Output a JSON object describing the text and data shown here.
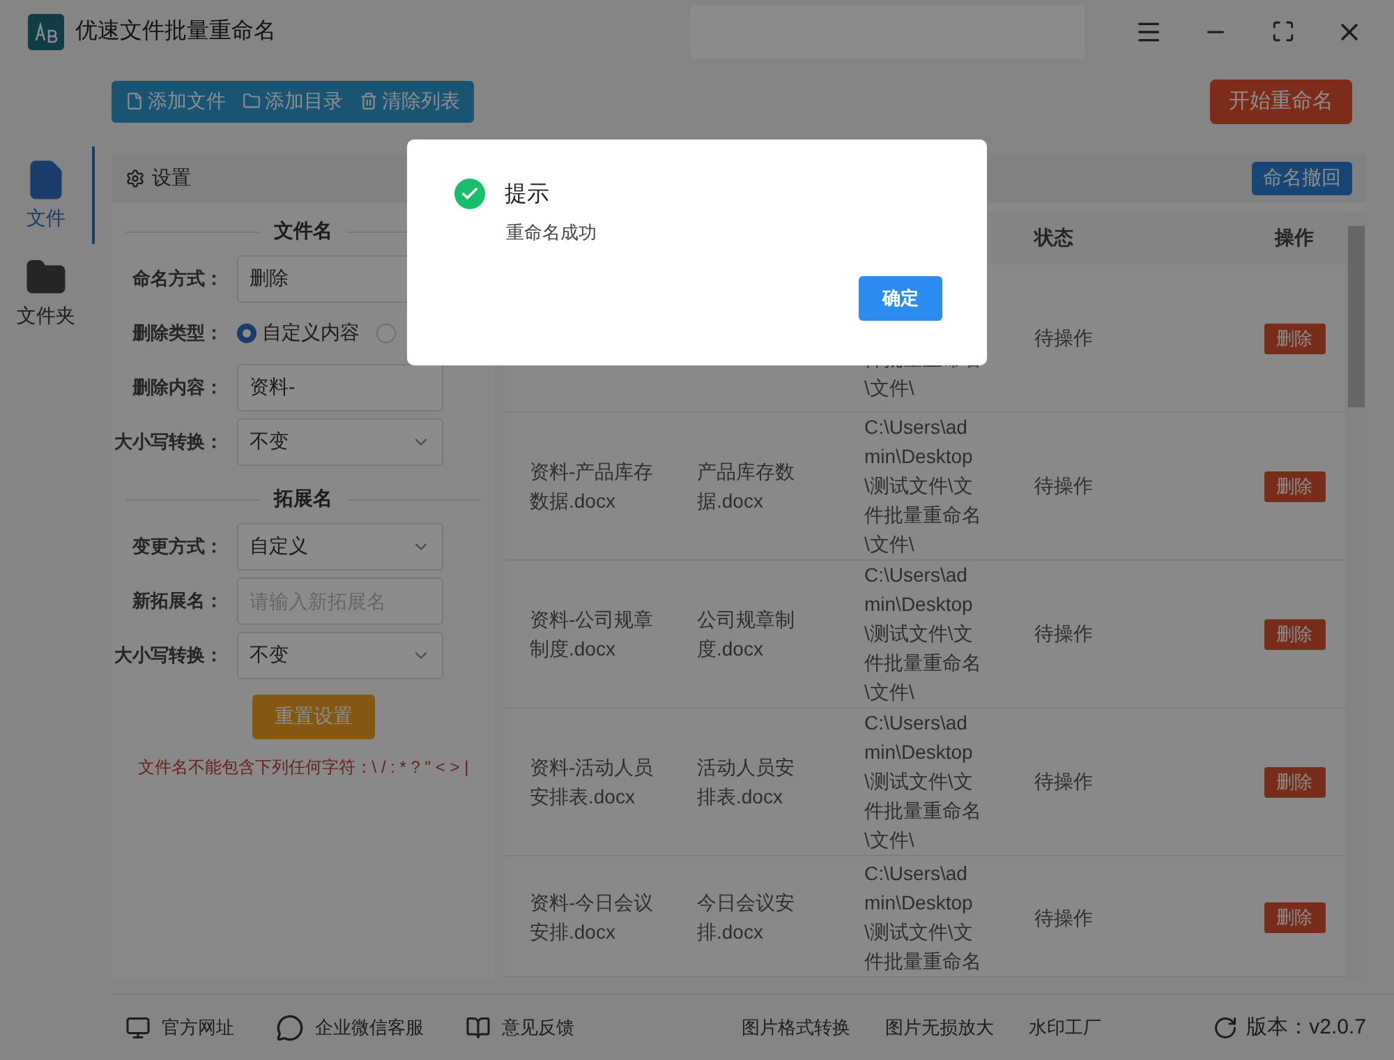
{
  "window": {
    "title": "优速文件批量重命名"
  },
  "toolbar": {
    "buttons": [
      {
        "kind": "file",
        "label": "添加文件"
      },
      {
        "kind": "folder",
        "label": "添加目录"
      },
      {
        "kind": "trash",
        "label": "清除列表"
      }
    ],
    "start_button": "开始重命名"
  },
  "sidebar": {
    "items": [
      {
        "kind": "file",
        "label": "文件",
        "selected": true
      },
      {
        "kind": "folder",
        "label": "文件夹",
        "selected": false
      }
    ]
  },
  "settings": {
    "title": "设置",
    "sections": [
      {
        "title": "文件名",
        "fields": [
          {
            "kind": "input",
            "label": "命名方式：",
            "value": "删除"
          },
          {
            "kind": "radio",
            "label": "删除类型：",
            "options": [
              {
                "label": "自定义内容",
                "selected": true
              },
              {
                "selected": false
              }
            ]
          },
          {
            "kind": "input",
            "label": "删除内容：",
            "value": "资料-"
          },
          {
            "kind": "select",
            "label": "大小写转换：",
            "value": "不变"
          }
        ]
      },
      {
        "title": "拓展名",
        "fields": [
          {
            "kind": "select",
            "label": "变更方式：",
            "value": "自定义"
          },
          {
            "kind": "input",
            "label": "新拓展名：",
            "placeholder": "请输入新拓展名"
          },
          {
            "kind": "select",
            "label": "大小写转换：",
            "value": "不变"
          }
        ]
      }
    ],
    "reset_button": "重置设置",
    "warning": "文件名不能包含下列任何字符：\\ / : * ? \" < > |"
  },
  "table": {
    "undo_button": "命名撤回",
    "headers": [
      "状态",
      "操作"
    ],
    "rows": [
      {
        "path": "件批量重命名\\文件\\",
        "status": "待操作",
        "action": "删除"
      },
      {
        "original": "资料-产品库存数据.docx",
        "renamed": "产品库存数据.docx",
        "path": "C:\\Users\\admin\\Desktop\\测试文件\\文件批量重命名\\文件\\",
        "status": "待操作",
        "action": "删除"
      },
      {
        "original": "资料-公司规章制度.docx",
        "renamed": "公司规章制度.docx",
        "path": "C:\\Users\\admin\\Desktop\\测试文件\\文件批量重命名\\文件\\",
        "status": "待操作",
        "action": "删除"
      },
      {
        "original": "资料-活动人员安排表.docx",
        "renamed": "活动人员安排表.docx",
        "path": "C:\\Users\\admin\\Desktop\\测试文件\\文件批量重命名\\文件\\",
        "status": "待操作",
        "action": "删除"
      },
      {
        "original": "资料-今日会议安排.docx",
        "renamed": "今日会议安排.docx",
        "path": "C:\\Users\\admin\\Desktop\\测试文件\\文件批量重命名",
        "status": "待操作",
        "action": "删除"
      }
    ]
  },
  "footer": {
    "links": [
      {
        "kind": "web",
        "label": "官方网址"
      },
      {
        "kind": "chat",
        "label": "企业微信客服"
      },
      {
        "kind": "feedback",
        "label": "意见反馈"
      }
    ],
    "tools": [
      "图片格式转换",
      "图片无损放大",
      "水印工厂"
    ],
    "version": "版本：v2.0.7"
  },
  "dialog": {
    "title": "提示",
    "message": "重命名成功",
    "button": "确定"
  }
}
